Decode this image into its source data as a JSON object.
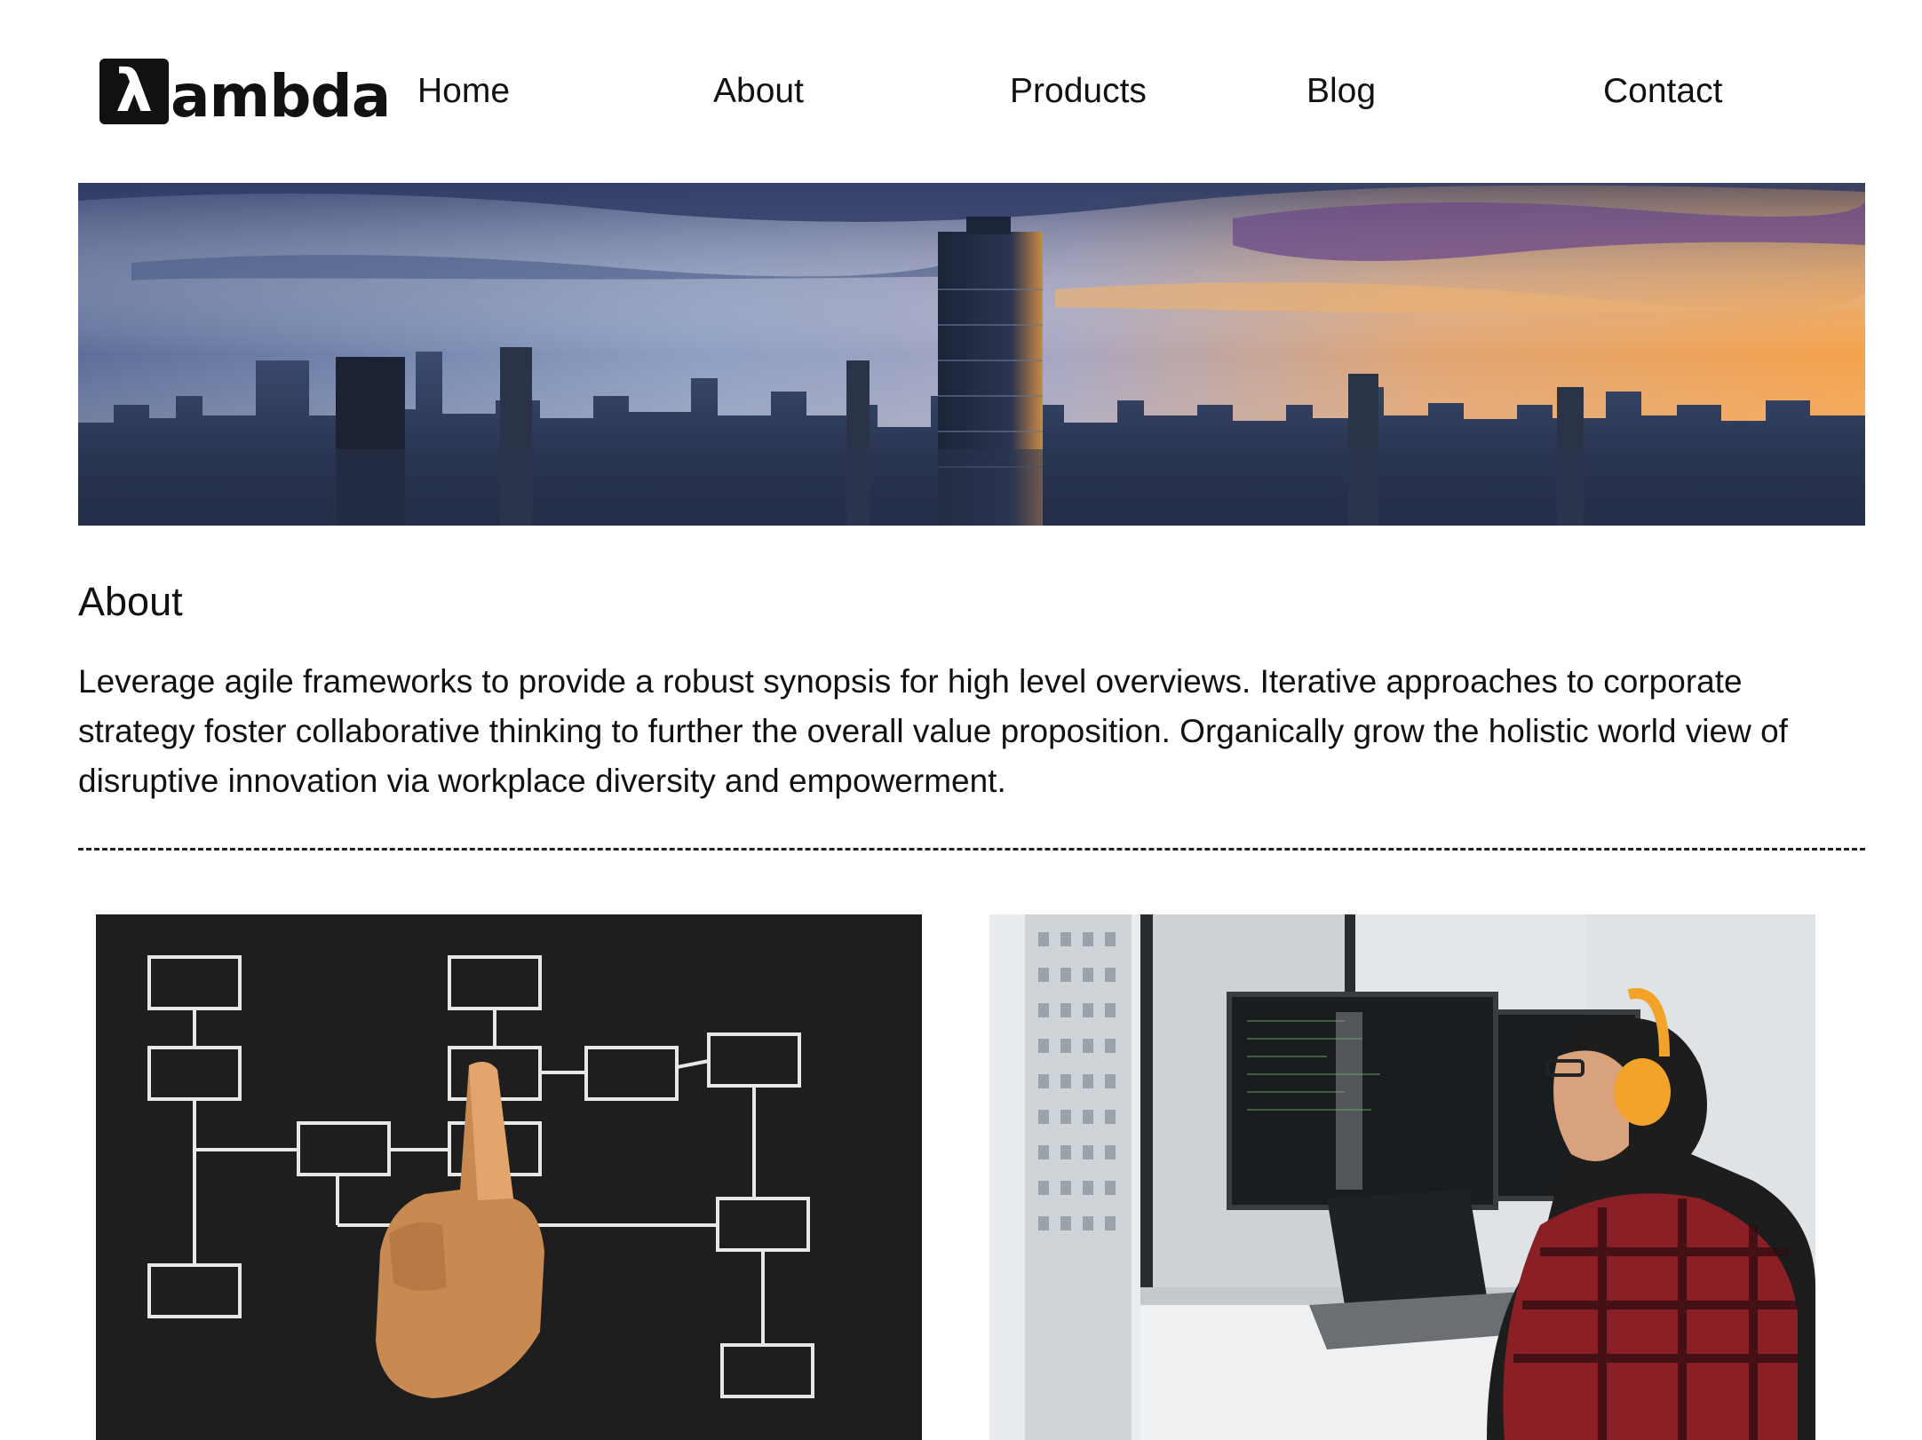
{
  "header": {
    "logo": {
      "mark": "λ",
      "text": "ambda",
      "icon": "lambda-logo-icon"
    },
    "nav": [
      {
        "label": "Home"
      },
      {
        "label": "About"
      },
      {
        "label": "Products"
      },
      {
        "label": "Blog"
      },
      {
        "label": "Contact"
      }
    ]
  },
  "hero": {
    "image": "city-skyline-sunset-photo"
  },
  "about": {
    "heading": "About",
    "body": "Leverage agile frameworks to provide a robust synopsis for high level overviews. Iterative approaches to corporate strategy foster collaborative thinking to further the overall value proposition. Organically grow the holistic world view of disruptive innovation via workplace diversity and empowerment."
  },
  "cards": [
    {
      "image": "flowchart-chalkboard-hand-photo"
    },
    {
      "image": "developer-at-computer-photo"
    }
  ],
  "colors": {
    "text": "#111111",
    "background": "#ffffff",
    "divider": "#222222"
  }
}
